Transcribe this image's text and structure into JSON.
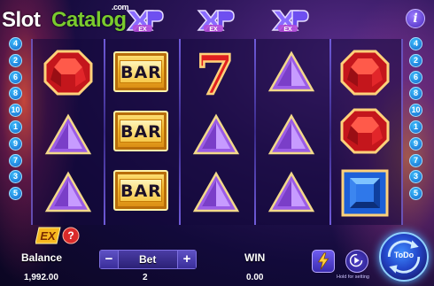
{
  "watermark": {
    "slot": "Slot",
    "catalog": "Catalog",
    "com": ".com"
  },
  "multiplier_badges": [
    {
      "name": "xp-badge-1",
      "text": "EX"
    },
    {
      "name": "xp-badge-2",
      "text": "EX"
    },
    {
      "name": "xp-badge-3",
      "text": "EX"
    }
  ],
  "info_button": {
    "label": "i"
  },
  "paylines_left": [
    "4",
    "2",
    "6",
    "8",
    "10",
    "1",
    "9",
    "7",
    "3",
    "5"
  ],
  "paylines_right": [
    "4",
    "2",
    "6",
    "8",
    "10",
    "1",
    "9",
    "7",
    "3",
    "5"
  ],
  "reels": [
    [
      "red-gem",
      "purple-triangle",
      "purple-triangle"
    ],
    [
      "bar",
      "bar",
      "bar"
    ],
    [
      "red-seven",
      "purple-triangle",
      "purple-triangle"
    ],
    [
      "purple-triangle",
      "purple-triangle",
      "purple-triangle"
    ],
    [
      "red-gem",
      "red-gem",
      "blue-square"
    ]
  ],
  "symbol_text": {
    "bar": "BAR",
    "seven": "7"
  },
  "ex_help": {
    "text": "EX",
    "help": "?"
  },
  "balance": {
    "label": "Balance",
    "value": "1,992.00"
  },
  "bet": {
    "label": "Bet",
    "value": "2",
    "minus": "−",
    "plus": "+"
  },
  "win": {
    "label": "WIN",
    "value": "0.00"
  },
  "spin": {
    "label": "ToDo",
    "hint": "Hold for setting"
  },
  "colors": {
    "accent": "#3fc3ff",
    "gold": "#f1b52a",
    "win_label": "#ffffff"
  }
}
